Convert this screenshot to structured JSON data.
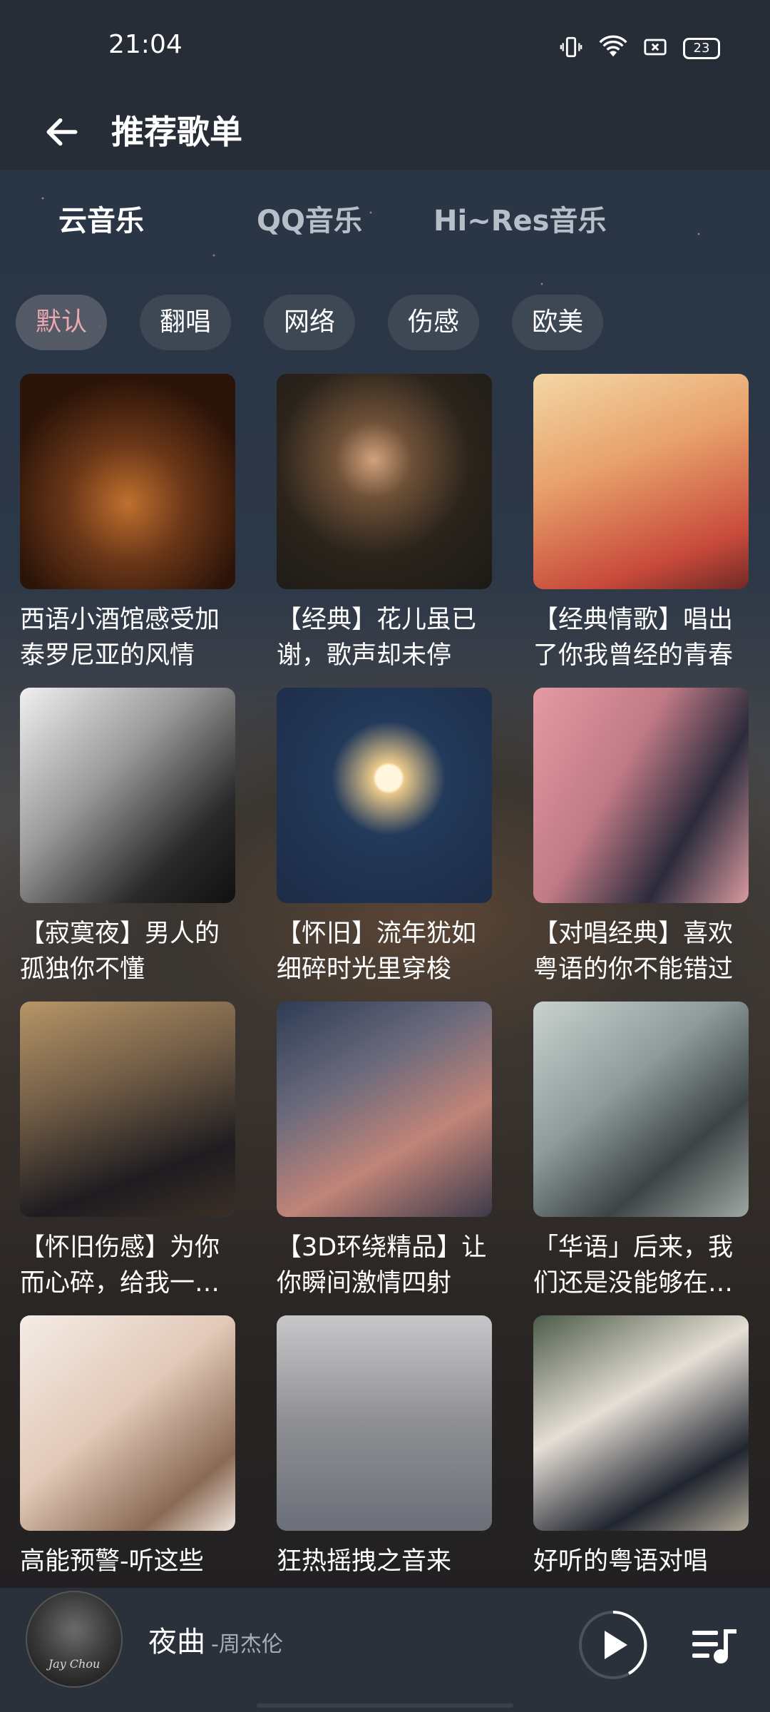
{
  "status": {
    "time": "21:04",
    "battery": "23"
  },
  "header": {
    "title": "推荐歌单"
  },
  "tabs": [
    {
      "label": "云音乐"
    },
    {
      "label": "QQ音乐"
    },
    {
      "label": "Hi~Res音乐"
    }
  ],
  "chips": [
    {
      "label": "默认"
    },
    {
      "label": "翻唱"
    },
    {
      "label": "网络"
    },
    {
      "label": "伤感"
    },
    {
      "label": "欧美"
    }
  ],
  "playlists": [
    {
      "title": "西语小酒馆感受加泰罗尼亚的风情"
    },
    {
      "title": "【经典】花儿虽已谢，歌声却未停"
    },
    {
      "title": "【经典情歌】唱出了你我曾经的青春"
    },
    {
      "title": "【寂寞夜】男人的孤独你不懂"
    },
    {
      "title": "【怀旧】流年犹如细碎时光里穿梭"
    },
    {
      "title": "【对唱经典】喜欢粤语的你不能错过"
    },
    {
      "title": "【怀旧伤感】为你而心碎，给我一个理由"
    },
    {
      "title": "【3D环绕精品】让你瞬间激情四射"
    },
    {
      "title": "「华语」后来，我们还是没能够在一起"
    },
    {
      "title": "高能预警-听这些"
    },
    {
      "title": "狂热摇拽之音来"
    },
    {
      "title": "好听的粤语对唱"
    }
  ],
  "player": {
    "song": "夜曲",
    "artist": "-周杰伦",
    "cover_text": "Jay Chou"
  }
}
